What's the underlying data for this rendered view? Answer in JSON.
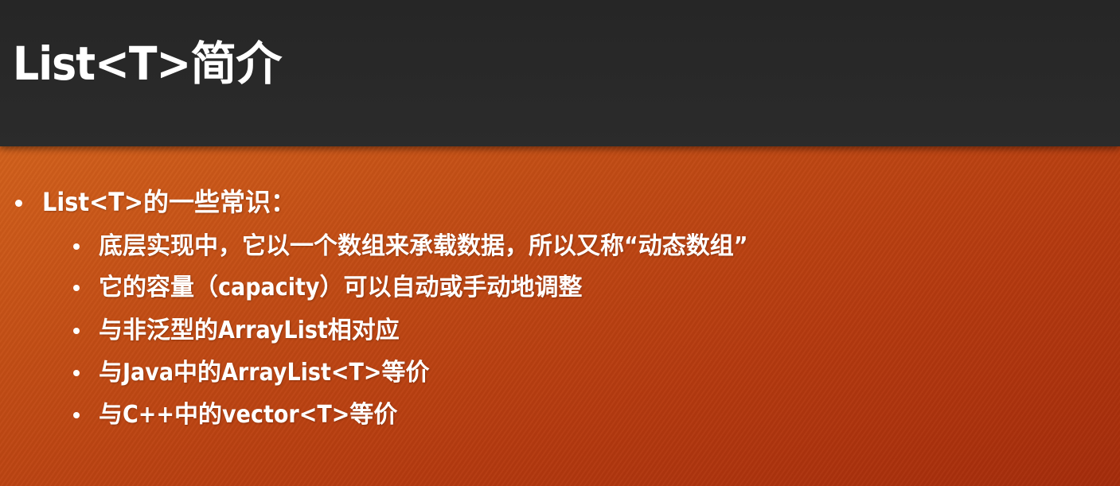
{
  "slide": {
    "title": "List<T>简介"
  },
  "content": {
    "heading": "List<T>的一些常识：",
    "points": [
      "底层实现中，它以一个数组来承载数据，所以又称“动态数组”",
      "它的容量（capacity）可以自动或手动地调整",
      "与非泛型的ArrayList相对应",
      "与Java中的ArrayList<T>等价",
      "与C++中的vector<T>等价"
    ]
  },
  "colors": {
    "title_bar": "#262626",
    "background_light": "#d2611c",
    "background_dark": "#a52c0b",
    "text": "#ffffff"
  }
}
